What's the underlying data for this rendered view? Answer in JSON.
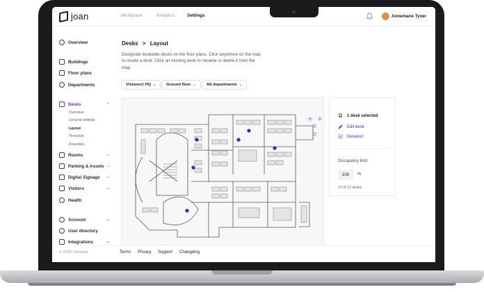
{
  "header": {
    "logo_text": "joan",
    "nav": [
      "Workplace",
      "Analytics",
      "Settings"
    ],
    "active_nav": "Settings",
    "user_name": "Annemarie Tyner",
    "avatar_color": "#E58D4E"
  },
  "sidebar": {
    "items": [
      {
        "label": "Overview",
        "icon": "globe-icon"
      },
      {
        "label": "Buildings",
        "icon": "building-icon"
      },
      {
        "label": "Floor plans",
        "icon": "map-icon"
      },
      {
        "label": "Departments",
        "icon": "people-icon"
      },
      {
        "label": "Desks",
        "icon": "desk-icon",
        "active": true,
        "expanded": true
      },
      {
        "label": "Rooms",
        "icon": "room-icon"
      },
      {
        "label": "Parking & Assets",
        "icon": "grid-icon"
      },
      {
        "label": "Digital Signage",
        "icon": "signage-icon"
      },
      {
        "label": "Visitors",
        "icon": "visitor-icon"
      },
      {
        "label": "Health",
        "icon": "shield-icon"
      },
      {
        "label": "Account",
        "icon": "account-icon"
      },
      {
        "label": "User directory",
        "icon": "users-icon"
      },
      {
        "label": "Integrations",
        "icon": "integrations-icon"
      }
    ],
    "desk_subitems": [
      "Overview",
      "General settings",
      "Layout",
      "Timeslots",
      "Amenities"
    ],
    "active_subitem": "Layout",
    "accent_color": "#6A2BD1"
  },
  "main": {
    "breadcrumb_parent": "Desks",
    "breadcrumb_separator": ">",
    "breadcrumb_current": "Layout",
    "description": "Designate bookable desks on the floor plans. Click anywhere on the map to create a desk. Click an existing desk to rename or delete it from the map.",
    "filters": {
      "building": "Visionect HQ",
      "floor": "Ground floor",
      "department": "All departments"
    }
  },
  "panel": {
    "selected_text": "1 desk selected",
    "edit_label": "Edit desk",
    "deselect_label": "Deselect",
    "occupancy_label": "Occupancy limit",
    "occupancy_value": "100",
    "occupancy_unit": "%",
    "desk_count": "12 of 12 desks"
  },
  "footer": {
    "copyright": "© 2026 Visionect",
    "links": [
      "Terms",
      "Privacy",
      "Support",
      "Changelog"
    ]
  }
}
